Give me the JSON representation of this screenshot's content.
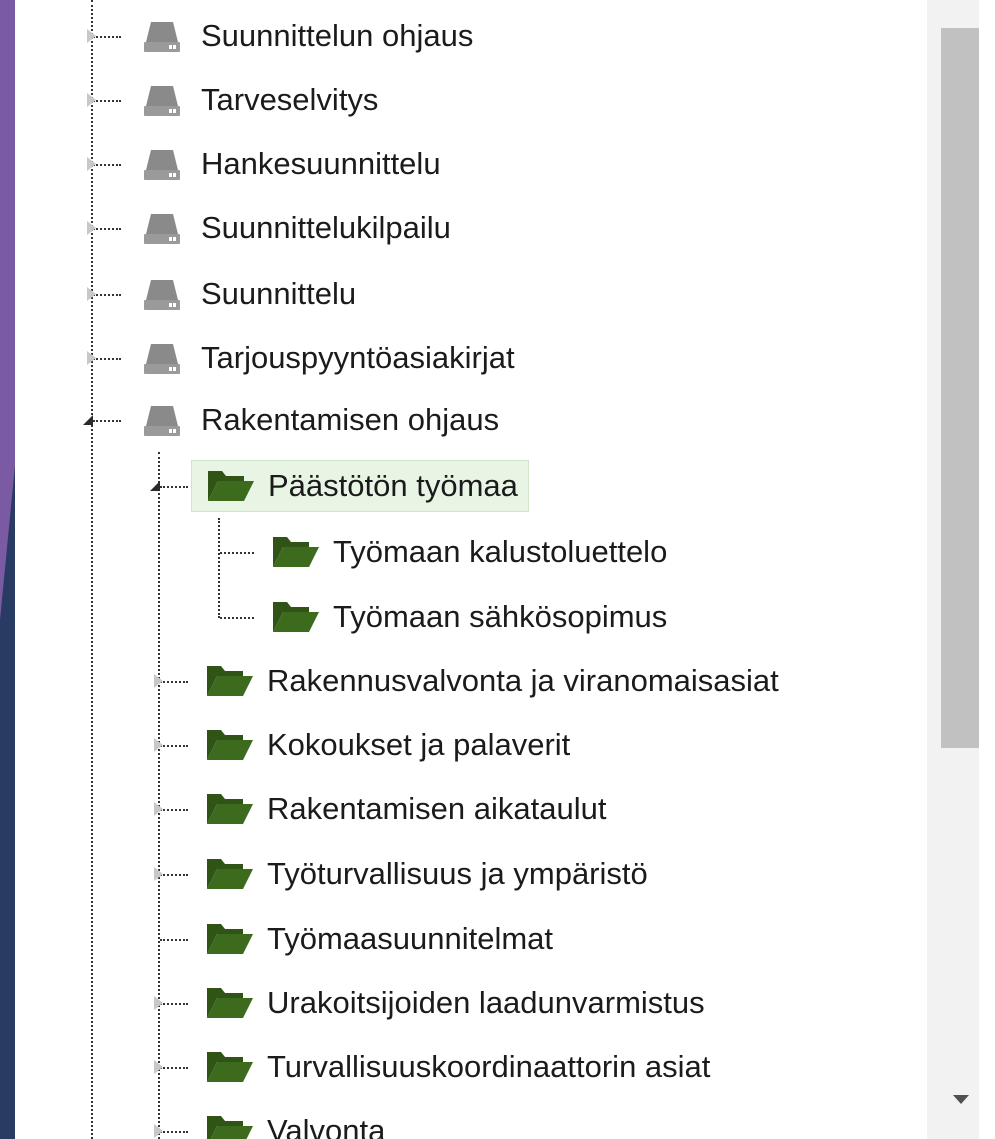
{
  "tree": {
    "root_items": [
      {
        "label": "Suunnittelun ohjaus",
        "icon": "drive-icon",
        "state": "collapsed"
      },
      {
        "label": "Tarveselvitys",
        "icon": "drive-icon",
        "state": "collapsed"
      },
      {
        "label": "Hankesuunnittelu",
        "icon": "drive-icon",
        "state": "collapsed"
      },
      {
        "label": "Suunnittelukilpailu",
        "icon": "drive-icon",
        "state": "collapsed"
      },
      {
        "label": "Suunnittelu",
        "icon": "drive-icon",
        "state": "collapsed"
      },
      {
        "label": "Tarjouspyyntöasiakirjat",
        "icon": "drive-icon",
        "state": "collapsed"
      },
      {
        "label": "Rakentamisen ohjaus",
        "icon": "drive-icon",
        "state": "expanded"
      }
    ],
    "child_items": [
      {
        "label": "Päästötön työmaa",
        "icon": "folder-open-icon",
        "state": "expanded",
        "selected": true
      },
      {
        "label": "Rakennusvalvonta ja viranomaisasiat",
        "icon": "folder-open-icon",
        "state": "collapsed"
      },
      {
        "label": "Kokoukset ja palaverit",
        "icon": "folder-open-icon",
        "state": "collapsed"
      },
      {
        "label": "Rakentamisen aikataulut",
        "icon": "folder-open-icon",
        "state": "collapsed"
      },
      {
        "label": "Työturvallisuus ja ympäristö",
        "icon": "folder-open-icon",
        "state": "collapsed"
      },
      {
        "label": "Työmaasuunnitelmat",
        "icon": "folder-open-icon",
        "state": "leaf"
      },
      {
        "label": "Urakoitsijoiden laadunvarmistus",
        "icon": "folder-open-icon",
        "state": "collapsed"
      },
      {
        "label": "Turvallisuuskoordinaattorin asiat",
        "icon": "folder-open-icon",
        "state": "collapsed"
      },
      {
        "label": "Valvonta",
        "icon": "folder-open-icon",
        "state": "collapsed"
      }
    ],
    "grandchild_items": [
      {
        "label": "Työmaan kalustoluettelo",
        "icon": "folder-open-icon",
        "state": "leaf"
      },
      {
        "label": "Työmaan sähkösopimus",
        "icon": "folder-open-icon",
        "state": "leaf"
      }
    ]
  },
  "colors": {
    "folder": "#3d6b1e",
    "drive": "#8a8a8a",
    "selected_bg": "#e8f5e4",
    "background_purple": "#7a5ba3",
    "background_navy": "#2a3b63"
  },
  "scrollbar": {
    "icon": "scroll-down-arrow-icon"
  }
}
